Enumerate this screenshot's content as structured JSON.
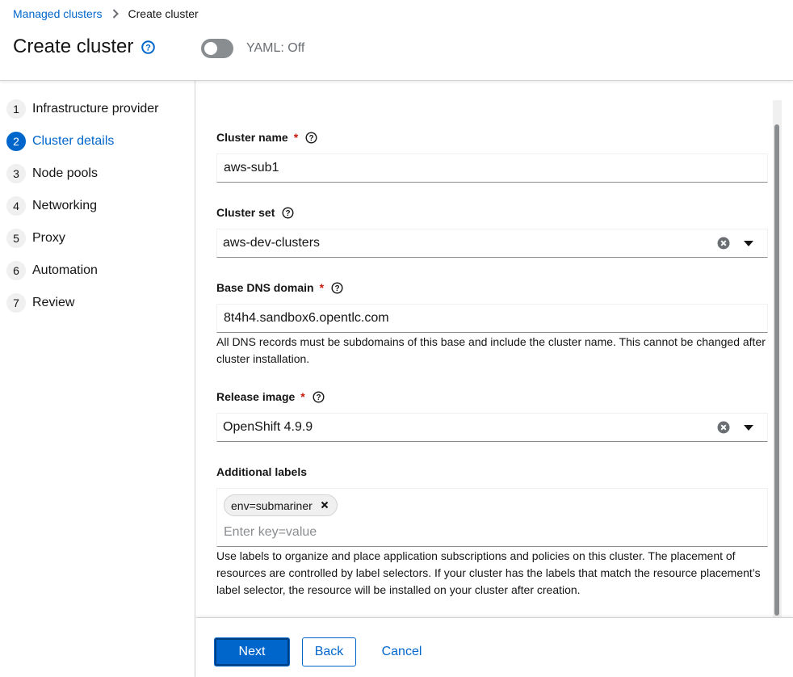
{
  "breadcrumb": {
    "parent": "Managed clusters",
    "current": "Create cluster"
  },
  "header": {
    "title": "Create cluster",
    "yaml_toggle_label": "YAML: Off"
  },
  "nav": {
    "items": [
      {
        "number": "1",
        "label": "Infrastructure provider"
      },
      {
        "number": "2",
        "label": "Cluster details"
      },
      {
        "number": "3",
        "label": "Node pools"
      },
      {
        "number": "4",
        "label": "Networking"
      },
      {
        "number": "5",
        "label": "Proxy"
      },
      {
        "number": "6",
        "label": "Automation"
      },
      {
        "number": "7",
        "label": "Review"
      }
    ],
    "active": "Cluster details"
  },
  "form": {
    "cluster_name": {
      "label": "Cluster name",
      "required_mark": "*",
      "value": "aws-sub1"
    },
    "cluster_set": {
      "label": "Cluster set",
      "value": "aws-dev-clusters"
    },
    "base_dns": {
      "label": "Base DNS domain",
      "required_mark": "*",
      "value": "8t4h4.sandbox6.opentlc.com",
      "helper": "All DNS records must be subdomains of this base and include the cluster name. This cannot be changed after cluster installation."
    },
    "release_image": {
      "label": "Release image",
      "required_mark": "*",
      "value": "OpenShift 4.9.9"
    },
    "additional_labels": {
      "label": "Additional labels",
      "chips": [
        "env=submariner"
      ],
      "placeholder": "Enter key=value",
      "helper": "Use labels to organize and place application subscriptions and policies on this cluster. The placement of resources are controlled by label selectors. If your cluster has the labels that match the resource placement’s label selector, the resource will be installed on your cluster after creation."
    }
  },
  "footer": {
    "next": "Next",
    "back": "Back",
    "cancel": "Cancel"
  },
  "colors": {
    "primary": "#0066cc",
    "required": "#c9190b",
    "border": "#8a8d90",
    "muted": "#6a6e73"
  }
}
